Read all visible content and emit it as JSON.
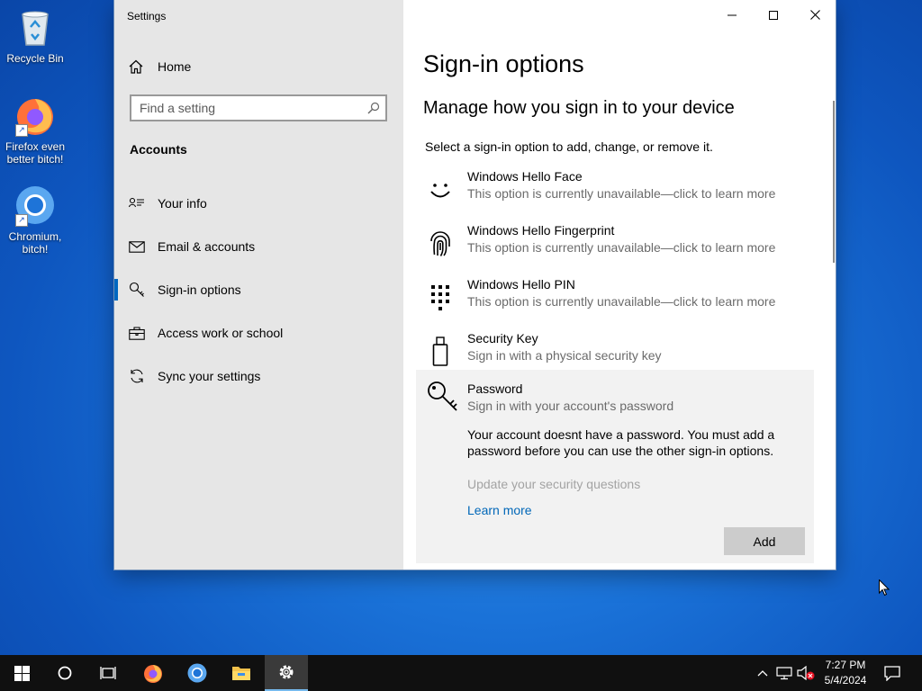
{
  "desktop": {
    "icons": [
      {
        "label": "Recycle Bin",
        "icon": "recycle-bin-icon"
      },
      {
        "label": "Firefox even better bitch!",
        "icon": "firefox-icon"
      },
      {
        "label": "Chromium, bitch!",
        "icon": "chromium-icon"
      }
    ]
  },
  "window": {
    "title": "Settings",
    "controls": {
      "minimize": "minimize-icon",
      "maximize": "maximize-icon",
      "close": "close-icon"
    }
  },
  "sidebar": {
    "home_label": "Home",
    "search_placeholder": "Find a setting",
    "section_label": "Accounts",
    "items": [
      {
        "label": "Your info",
        "icon": "person-icon"
      },
      {
        "label": "Email & accounts",
        "icon": "mail-icon"
      },
      {
        "label": "Sign-in options",
        "icon": "key-icon",
        "selected": true
      },
      {
        "label": "Access work or school",
        "icon": "briefcase-icon"
      },
      {
        "label": "Sync your settings",
        "icon": "sync-icon"
      }
    ]
  },
  "main": {
    "title": "Sign-in options",
    "subtitle": "Manage how you sign in to your device",
    "description": "Select a sign-in option to add, change, or remove it.",
    "options": [
      {
        "name": "Windows Hello Face",
        "sub": "This option is currently unavailable—click to learn more",
        "icon": "face-icon"
      },
      {
        "name": "Windows Hello Fingerprint",
        "sub": "This option is currently unavailable—click to learn more",
        "icon": "fingerprint-icon"
      },
      {
        "name": "Windows Hello PIN",
        "sub": "This option is currently unavailable—click to learn more",
        "icon": "pin-keypad-icon"
      },
      {
        "name": "Security Key",
        "sub": "Sign in with a physical security key",
        "icon": "usb-key-icon"
      }
    ],
    "password": {
      "name": "Password",
      "sub": "Sign in with your account's password",
      "message": "Your account doesnt have a password. You must add a password before you can use the other sign-in options.",
      "security_questions_link": "Update your security questions",
      "learn_more": "Learn more",
      "add_button": "Add"
    }
  },
  "taskbar": {
    "time": "7:27 PM",
    "date": "5/4/2024",
    "buttons": [
      "start-icon",
      "search-circle-icon",
      "task-view-icon",
      "firefox-icon",
      "chromium-icon",
      "file-explorer-icon",
      "settings-gear-icon"
    ],
    "active": "settings-gear-icon"
  },
  "colors": {
    "accent": "#0067c0",
    "link": "#0067b8",
    "sidebar_bg": "#e6e6e6",
    "panel_bg": "#f2f2f2",
    "taskbar_bg": "#101010"
  }
}
